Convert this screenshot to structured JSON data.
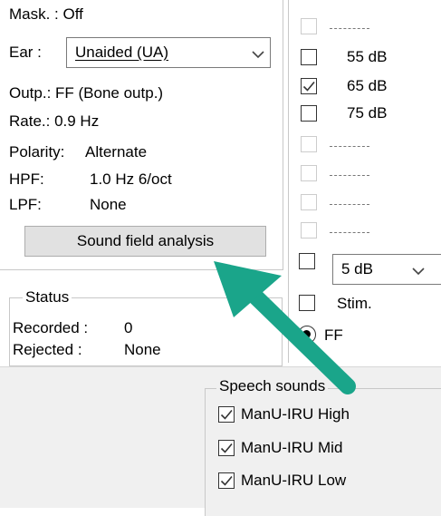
{
  "left_panel": {
    "mask_label": "Mask. : Off",
    "ear_label": "Ear :",
    "ear_value": "Unaided (UA)",
    "output_label": "Outp.: FF (Bone outp.)",
    "rate_label": "Rate.: 0.9 Hz",
    "polarity_key": "Polarity:",
    "polarity_value": "Alternate",
    "hpf_key": "HPF:",
    "hpf_value": "1.0 Hz 6/oct",
    "lpf_key": "LPF:",
    "lpf_value": "None",
    "sound_field_button": "Sound field analysis"
  },
  "status": {
    "title": "Status",
    "recorded_key": "Recorded :",
    "recorded_value": "0",
    "rejected_key": "Rejected :",
    "rejected_value": "None"
  },
  "right_panel": {
    "levels": [
      {
        "label": "",
        "checked": false,
        "enabled": false
      },
      {
        "label": "55 dB",
        "checked": false,
        "enabled": true
      },
      {
        "label": "65 dB",
        "checked": true,
        "enabled": true
      },
      {
        "label": "75 dB",
        "checked": false,
        "enabled": true
      },
      {
        "label": "",
        "checked": false,
        "enabled": false
      },
      {
        "label": "",
        "checked": false,
        "enabled": false
      },
      {
        "label": "",
        "checked": false,
        "enabled": false
      },
      {
        "label": "",
        "checked": false,
        "enabled": false
      }
    ],
    "step_value": "5 dB",
    "stim_label": "Stim.",
    "ff_label": "FF",
    "ff_selected": true
  },
  "speech_sounds": {
    "title": "Speech sounds",
    "items": [
      {
        "label": "ManU-IRU High",
        "checked": true
      },
      {
        "label": "ManU-IRU Mid",
        "checked": true
      },
      {
        "label": "ManU-IRU Low",
        "checked": true
      }
    ]
  },
  "annotation": {
    "arrow_color": "#1aa58a"
  }
}
